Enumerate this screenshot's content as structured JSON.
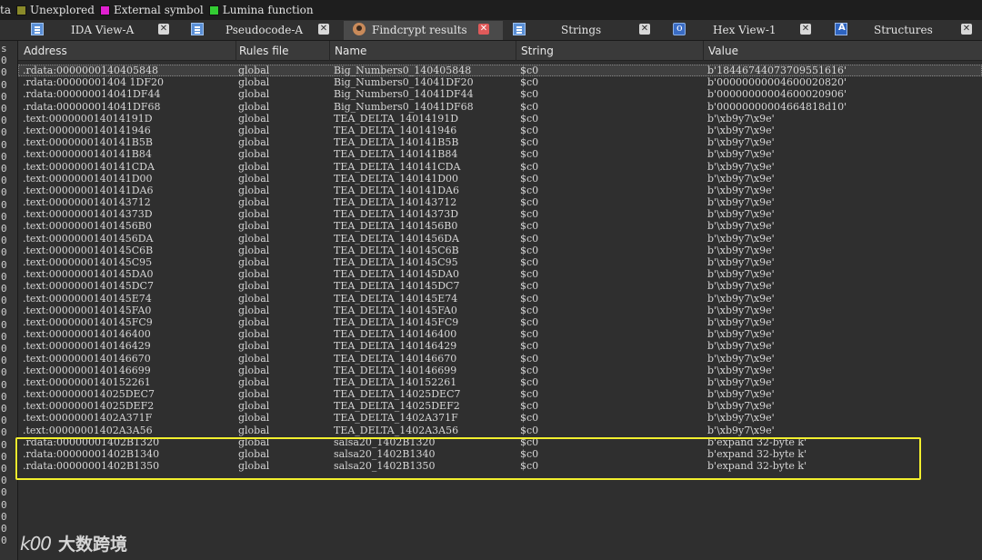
{
  "legend": {
    "items": [
      {
        "label": "ta",
        "color": ""
      },
      {
        "label": "Unexplored",
        "color": "#8a8a2a"
      },
      {
        "label": "External symbol",
        "color": "#e020d0"
      },
      {
        "label": "Lumina function",
        "color": "#33cc33"
      }
    ]
  },
  "tabs": [
    {
      "label": "IDA View-A",
      "icon": "doc-icon",
      "active": false
    },
    {
      "label": "Pseudocode-A",
      "icon": "doc-icon",
      "active": false
    },
    {
      "label": "Findcrypt results",
      "icon": "findcrypt-icon",
      "active": true
    },
    {
      "label": "Strings",
      "icon": "strings-icon",
      "active": false
    },
    {
      "label": "Hex View-1",
      "icon": "hex-icon",
      "active": false
    },
    {
      "label": "Structures",
      "icon": "structures-icon",
      "active": false
    }
  ],
  "table": {
    "columns": [
      "Address",
      "Rules file",
      "Name",
      "String",
      "Value"
    ],
    "rows": [
      [
        ".rdata:0000000140405848",
        "global",
        "Big_Numbers0_140405848",
        "$c0",
        "b'18446744073709551616'"
      ],
      [
        ".rdata:00000001404 1DF20",
        "global",
        "Big_Numbers0_14041DF20",
        "$c0",
        "b'00000000004600020820'"
      ],
      [
        ".rdata:000000014041DF44",
        "global",
        "Big_Numbers0_14041DF44",
        "$c0",
        "b'00000000004600020906'"
      ],
      [
        ".rdata:000000014041DF68",
        "global",
        "Big_Numbers0_14041DF68",
        "$c0",
        "b'00000000004664818d10'"
      ],
      [
        ".text:000000014014191D",
        "global",
        "TEA_DELTA_14014191D",
        "$c0",
        "b'\\xb9y7\\x9e'"
      ],
      [
        ".text:0000000140141946",
        "global",
        "TEA_DELTA_140141946",
        "$c0",
        "b'\\xb9y7\\x9e'"
      ],
      [
        ".text:0000000140141B5B",
        "global",
        "TEA_DELTA_140141B5B",
        "$c0",
        "b'\\xb9y7\\x9e'"
      ],
      [
        ".text:0000000140141B84",
        "global",
        "TEA_DELTA_140141B84",
        "$c0",
        "b'\\xb9y7\\x9e'"
      ],
      [
        ".text:0000000140141CDA",
        "global",
        "TEA_DELTA_140141CDA",
        "$c0",
        "b'\\xb9y7\\x9e'"
      ],
      [
        ".text:0000000140141D00",
        "global",
        "TEA_DELTA_140141D00",
        "$c0",
        "b'\\xb9y7\\x9e'"
      ],
      [
        ".text:0000000140141DA6",
        "global",
        "TEA_DELTA_140141DA6",
        "$c0",
        "b'\\xb9y7\\x9e'"
      ],
      [
        ".text:0000000140143712",
        "global",
        "TEA_DELTA_140143712",
        "$c0",
        "b'\\xb9y7\\x9e'"
      ],
      [
        ".text:000000014014373D",
        "global",
        "TEA_DELTA_14014373D",
        "$c0",
        "b'\\xb9y7\\x9e'"
      ],
      [
        ".text:00000001401456B0",
        "global",
        "TEA_DELTA_1401456B0",
        "$c0",
        "b'\\xb9y7\\x9e'"
      ],
      [
        ".text:00000001401456DA",
        "global",
        "TEA_DELTA_1401456DA",
        "$c0",
        "b'\\xb9y7\\x9e'"
      ],
      [
        ".text:0000000140145C6B",
        "global",
        "TEA_DELTA_140145C6B",
        "$c0",
        "b'\\xb9y7\\x9e'"
      ],
      [
        ".text:0000000140145C95",
        "global",
        "TEA_DELTA_140145C95",
        "$c0",
        "b'\\xb9y7\\x9e'"
      ],
      [
        ".text:0000000140145DA0",
        "global",
        "TEA_DELTA_140145DA0",
        "$c0",
        "b'\\xb9y7\\x9e'"
      ],
      [
        ".text:0000000140145DC7",
        "global",
        "TEA_DELTA_140145DC7",
        "$c0",
        "b'\\xb9y7\\x9e'"
      ],
      [
        ".text:0000000140145E74",
        "global",
        "TEA_DELTA_140145E74",
        "$c0",
        "b'\\xb9y7\\x9e'"
      ],
      [
        ".text:0000000140145FA0",
        "global",
        "TEA_DELTA_140145FA0",
        "$c0",
        "b'\\xb9y7\\x9e'"
      ],
      [
        ".text:0000000140145FC9",
        "global",
        "TEA_DELTA_140145FC9",
        "$c0",
        "b'\\xb9y7\\x9e'"
      ],
      [
        ".text:0000000140146400",
        "global",
        "TEA_DELTA_140146400",
        "$c0",
        "b'\\xb9y7\\x9e'"
      ],
      [
        ".text:0000000140146429",
        "global",
        "TEA_DELTA_140146429",
        "$c0",
        "b'\\xb9y7\\x9e'"
      ],
      [
        ".text:0000000140146670",
        "global",
        "TEA_DELTA_140146670",
        "$c0",
        "b'\\xb9y7\\x9e'"
      ],
      [
        ".text:0000000140146699",
        "global",
        "TEA_DELTA_140146699",
        "$c0",
        "b'\\xb9y7\\x9e'"
      ],
      [
        ".text:0000000140152261",
        "global",
        "TEA_DELTA_140152261",
        "$c0",
        "b'\\xb9y7\\x9e'"
      ],
      [
        ".text:000000014025DEC7",
        "global",
        "TEA_DELTA_14025DEC7",
        "$c0",
        "b'\\xb9y7\\x9e'"
      ],
      [
        ".text:000000014025DEF2",
        "global",
        "TEA_DELTA_14025DEF2",
        "$c0",
        "b'\\xb9y7\\x9e'"
      ],
      [
        ".text:00000001402A371F",
        "global",
        "TEA_DELTA_1402A371F",
        "$c0",
        "b'\\xb9y7\\x9e'"
      ],
      [
        ".text:00000001402A3A56",
        "global",
        "TEA_DELTA_1402A3A56",
        "$c0",
        "b'\\xb9y7\\x9e'"
      ],
      [
        ".rdata:00000001402B1320",
        "global",
        "salsa20_1402B1320",
        "$c0",
        "b'expand 32-byte k'"
      ],
      [
        ".rdata:00000001402B1340",
        "global",
        "salsa20_1402B1340",
        "$c0",
        "b'expand 32-byte k'"
      ],
      [
        ".rdata:00000001402B1350",
        "global",
        "salsa20_1402B1350",
        "$c0",
        "b'expand 32-byte k'"
      ]
    ]
  },
  "gutter": {
    "chars": [
      "s",
      "0",
      "0",
      "0",
      "0",
      "0",
      "0",
      "0",
      "0",
      "0",
      "0",
      "0",
      "0",
      "0",
      "0",
      "0",
      "0",
      "0",
      "0",
      "0",
      "0",
      "0",
      "0",
      "0",
      "0",
      "0",
      "0",
      "0",
      "0",
      "0",
      "0",
      "0",
      "0",
      "0",
      "0",
      "0",
      "0",
      "0",
      "0",
      "0",
      "0",
      "0"
    ]
  },
  "watermark": {
    "logo": "k00",
    "text": "大数跨境"
  },
  "colors": {
    "highlight": "#f2ef2e",
    "active_tab_close": "#e05a5a"
  }
}
